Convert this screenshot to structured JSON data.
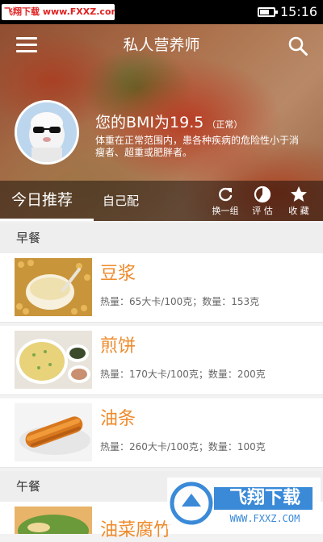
{
  "status_bar": {
    "watermark": "飞翔下载 www.FXXZ.com",
    "time": "15:16",
    "battery_icon": "battery-icon"
  },
  "header": {
    "title": "私人营养师",
    "menu_icon": "hamburger-menu-icon",
    "search_icon": "search-icon"
  },
  "profile": {
    "bmi_text": "您的BMI为19.5",
    "bmi_status": "（正常）",
    "description": "体重在正常范围内，患各种疾病的危险性小于消瘦者、超重或肥胖者。"
  },
  "tabs": {
    "today": "今日推荐",
    "custom": "自己配"
  },
  "actions": [
    {
      "label": "换一组",
      "icon": "refresh-icon"
    },
    {
      "label": "评 估",
      "icon": "pie-chart-icon"
    },
    {
      "label": "收 藏",
      "icon": "star-icon"
    }
  ],
  "meals": [
    {
      "title": "早餐",
      "items": [
        {
          "name": "豆浆",
          "info": "热量：65大卡/100克；数量：153克"
        },
        {
          "name": "煎饼",
          "info": "热量：170大卡/100克；数量：200克"
        },
        {
          "name": "油条",
          "info": "热量：260大卡/100克；数量：100克"
        }
      ]
    },
    {
      "title": "午餐",
      "items": [
        {
          "name": "油菜腐竹",
          "info": ""
        }
      ]
    }
  ],
  "watermark_bottom": {
    "brand": "飞翔下载",
    "url": "WWW.FXXZ.COM"
  },
  "colors": {
    "accent": "#ee8a2a",
    "tabbar_bg": "#000000",
    "section_bg": "#eeeeee"
  }
}
